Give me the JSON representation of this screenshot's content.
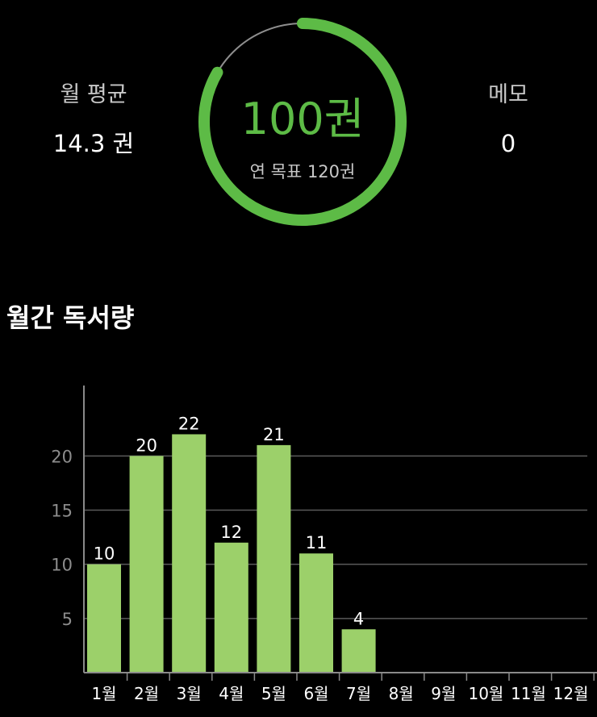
{
  "summary": {
    "avg_label": "월 평균",
    "avg_value": "14.3 권",
    "memo_label": "메모",
    "memo_value": "0"
  },
  "goal": {
    "count_text": "100권",
    "target_text": "연 목표 120권",
    "read": 100,
    "target": 120
  },
  "colors": {
    "accent": "#5dbb46",
    "bar": "#9cd06a",
    "track": "#8e8e8e",
    "grid": "#5a5a5a",
    "axis": "#8a8a8a"
  },
  "section": {
    "title": "월간 독서량"
  },
  "chart_data": {
    "type": "bar",
    "categories": [
      "1월",
      "2월",
      "3월",
      "4월",
      "5월",
      "6월",
      "7월",
      "8월",
      "9월",
      "10월",
      "11월",
      "12월"
    ],
    "values": [
      10,
      20,
      22,
      12,
      21,
      11,
      4,
      null,
      null,
      null,
      null,
      null
    ],
    "yticks": [
      5,
      10,
      15,
      20
    ],
    "ylim": [
      0,
      26.5
    ],
    "grid": true,
    "title": "",
    "xlabel": "",
    "ylabel": ""
  }
}
